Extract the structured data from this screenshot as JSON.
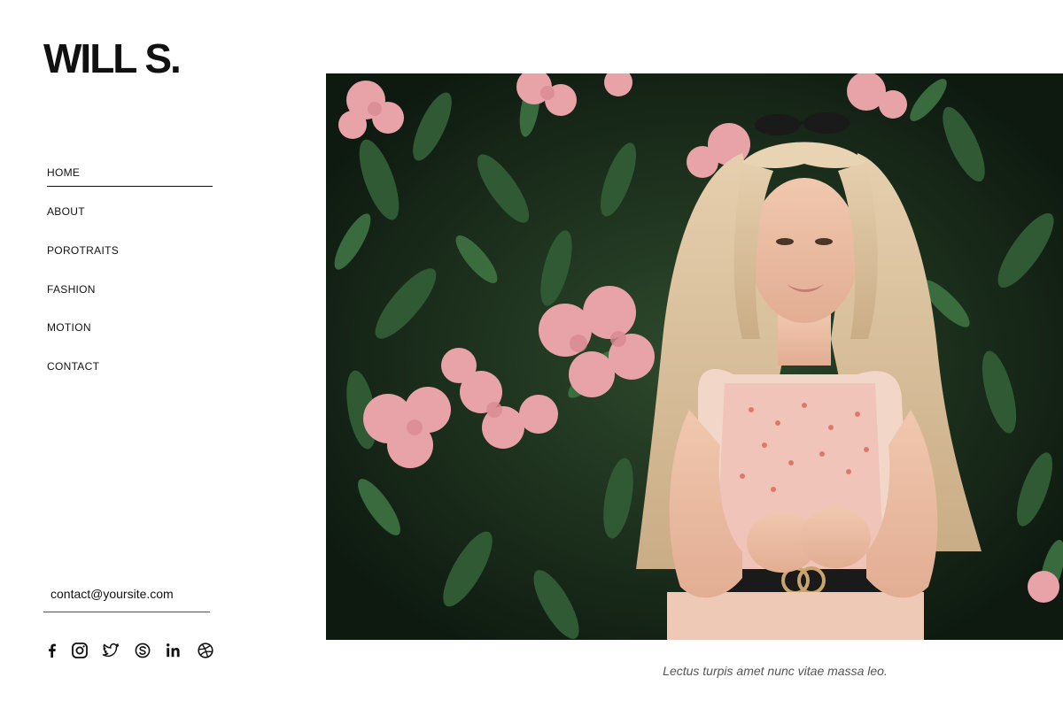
{
  "site": {
    "logo": "WILL S."
  },
  "nav": {
    "items": [
      {
        "label": "HOME",
        "active": true
      },
      {
        "label": "ABOUT",
        "active": false
      },
      {
        "label": "POROTRAITS",
        "active": false
      },
      {
        "label": "FASHION",
        "active": false
      },
      {
        "label": "MOTION",
        "active": false
      },
      {
        "label": "CONTACT",
        "active": false
      }
    ]
  },
  "contact": {
    "email": "contact@yoursite.com"
  },
  "social": {
    "icons": [
      "facebook-icon",
      "instagram-icon",
      "twitter-icon",
      "skype-icon",
      "linkedin-icon",
      "dribbble-icon"
    ]
  },
  "hero": {
    "image_subject": "portrait of a blonde woman in front of green foliage with pink flowers",
    "caption": "Lectus turpis amet nunc vitae massa leo."
  },
  "colors": {
    "text": "#111111",
    "caption": "#555555",
    "background": "#ffffff",
    "foliage": "#1f3a22",
    "flower": "#e8a3a8"
  }
}
